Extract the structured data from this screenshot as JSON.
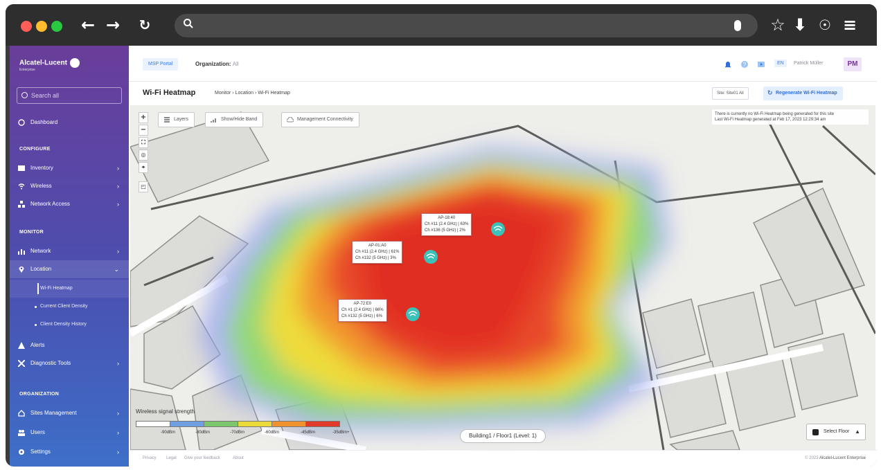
{
  "browser": {
    "nav_icons": [
      "back-arrow-icon",
      "forward-arrow-icon",
      "reload-icon"
    ],
    "toolbar_icons": [
      "star-icon",
      "download-icon",
      "account-icon",
      "menu-icon"
    ],
    "url": ""
  },
  "brand": {
    "name": "Alcatel-Lucent",
    "sub": "Enterprise"
  },
  "sidebar": {
    "search_placeholder": "Search all",
    "dashboard": "Dashboard",
    "sections": {
      "configure": "CONFIGURE",
      "monitor": "MONITOR",
      "organization": "ORGANIZATION"
    },
    "items": {
      "inventory": "Inventory",
      "wireless": "Wireless",
      "network_access": "Network Access",
      "network": "Network",
      "location": "Location",
      "alerts": "Alerts",
      "diagnostic_tools": "Diagnostic Tools",
      "sites_management": "Sites Management",
      "users": "Users",
      "settings": "Settings"
    },
    "location_sub": {
      "heatmap": "Wi-Fi Heatmap",
      "client_density": "Current Client Density",
      "density_history": "Client Density History"
    }
  },
  "topbar": {
    "msp_portal": "MSP Portal",
    "org_label": "Organization:",
    "org_value": "All",
    "language": "EN",
    "user_name": "Patrick Müller",
    "avatar_initials": "PM"
  },
  "page": {
    "title": "Wi-Fi Heatmap",
    "breadcrumb": "Monitor › Location › Wi-Fi Heatmap",
    "site_chip": "Site: Site01 All",
    "regenerate": "Regenerate Wi-Fi Heatmap"
  },
  "map": {
    "buttons": {
      "layers": "Layers",
      "show_hide_band": "Show/Hide Band",
      "management_connectivity": "Management Connectivity"
    },
    "notice_line1": "There is currently no Wi-Fi Heatmap being generated for this site",
    "notice_line2": "Last Wi-Fi Heatmap generated at Feb 17, 2023 12:29:34 am",
    "access_points": [
      {
        "name": "AP-18:40",
        "line1": "Ch #11 (2.4 GHz) | 63%",
        "line2": "Ch #136 (5 GHz) | 2%"
      },
      {
        "name": "AP-01:A0",
        "line1": "Ch #11 (2.4 GHz) | 61%",
        "line2": "Ch #132 (5 GHz) | 3%"
      },
      {
        "name": "AP-72:E0",
        "line1": "Ch #1 (2.4 GHz) | 66%",
        "line2": "Ch #132 (5 GHz) | 6%"
      }
    ],
    "legend": {
      "title": "Wireless signal strength",
      "labels": [
        "-90dBm",
        "-80dBm",
        "-70dBm",
        "-60dBm",
        "-45dBm",
        "-35dBm+"
      ],
      "colors": [
        "#ffffff",
        "#6f9fe0",
        "#7cc66e",
        "#ecd93a",
        "#f0912f",
        "#e23a2a"
      ]
    },
    "floor_label": "Building1 / Floor1 (Level: 1)",
    "select_floor": "Select Floor"
  },
  "footer": {
    "links": [
      "Privacy",
      "Legal",
      "Give your feedback",
      "About"
    ],
    "copyright": "© 2023",
    "company": "Alcatel-Lucent Enterprise"
  }
}
